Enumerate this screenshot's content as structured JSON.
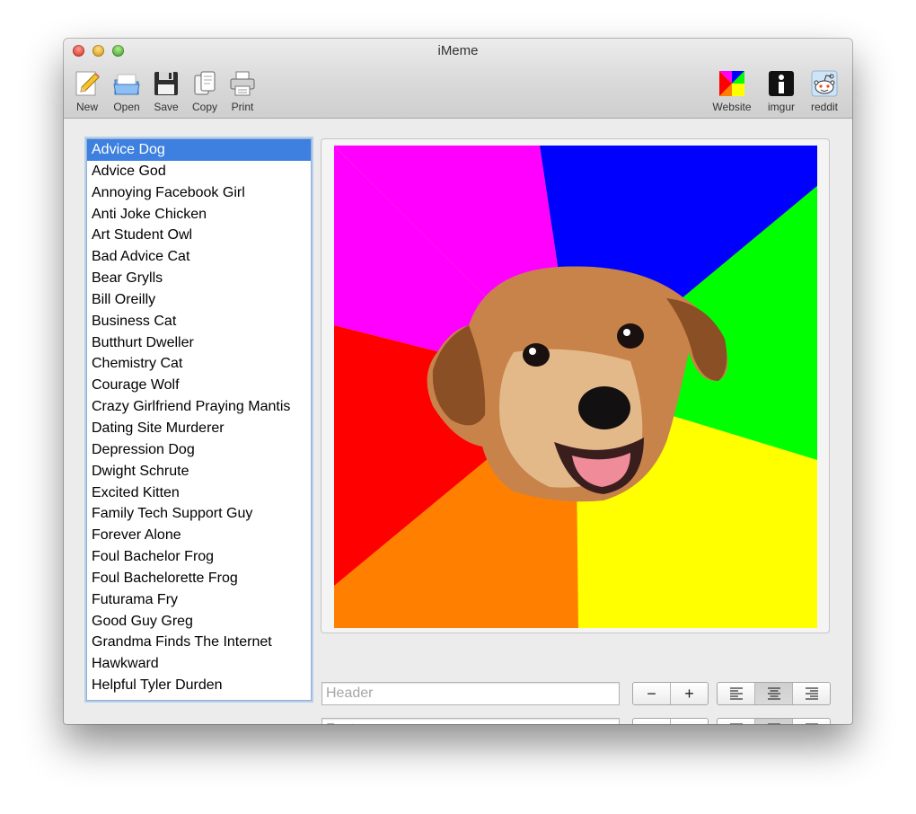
{
  "window": {
    "title": "iMeme"
  },
  "toolbar": {
    "new_label": "New",
    "open_label": "Open",
    "save_label": "Save",
    "copy_label": "Copy",
    "print_label": "Print",
    "website_label": "Website",
    "imgur_label": "imgur",
    "reddit_label": "reddit"
  },
  "meme_list": {
    "selected": "Advice Dog",
    "items": [
      "Advice Dog",
      "Advice God",
      "Annoying Facebook Girl",
      "Anti Joke Chicken",
      "Art Student Owl",
      "Bad Advice Cat",
      "Bear Grylls",
      "Bill Oreilly",
      "Business Cat",
      "Butthurt Dweller",
      "Chemistry Cat",
      "Courage Wolf",
      "Crazy Girlfriend Praying Mantis",
      "Dating Site Murderer",
      "Depression Dog",
      "Dwight Schrute",
      "Excited Kitten",
      "Family Tech Support Guy",
      "Forever Alone",
      "Foul Bachelor Frog",
      "Foul Bachelorette Frog",
      "Futurama Fry",
      "Good Guy Greg",
      "Grandma Finds The Internet",
      "Hawkward",
      "Helpful Tyler Durden"
    ]
  },
  "preview": {
    "image": "advice-dog",
    "colors": [
      "#ff00ff",
      "#0000ff",
      "#00ff00",
      "#ffff00",
      "#ff8000",
      "#ff0000"
    ]
  },
  "header": {
    "value": "",
    "placeholder": "Header",
    "minus": "−",
    "plus": "+"
  },
  "footer": {
    "value": "",
    "placeholder": "Footer",
    "minus": "−",
    "plus": "+"
  },
  "alignment": {
    "header_selected": "center",
    "footer_selected": "center"
  },
  "icons": [
    "new-icon",
    "open-icon",
    "save-icon",
    "copy-icon",
    "print-icon",
    "website-icon",
    "imgur-icon",
    "reddit-icon"
  ]
}
